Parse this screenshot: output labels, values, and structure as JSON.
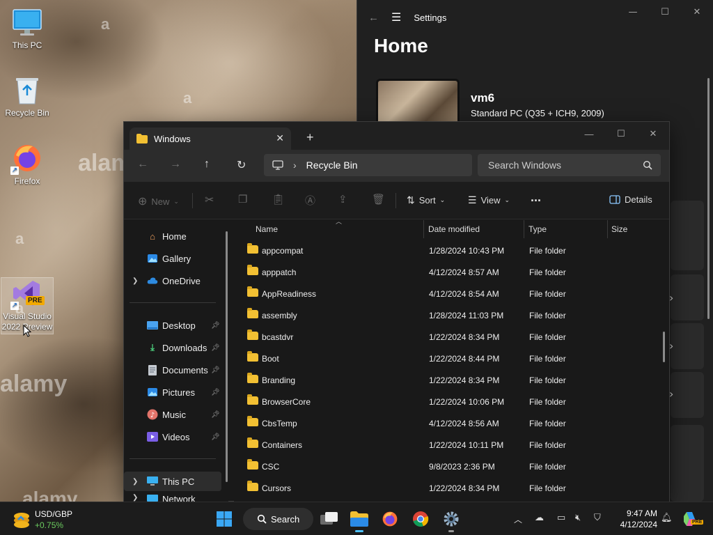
{
  "desktop": {
    "icons": [
      {
        "label": "This PC"
      },
      {
        "label": "Recycle Bin"
      },
      {
        "label": "Firefox"
      },
      {
        "label": "Visual Studio 2022 Preview",
        "badge": "PRE"
      }
    ],
    "watermarks": [
      "a",
      "alamy",
      "alamy",
      "a",
      "a",
      "a",
      "alamy"
    ]
  },
  "settings": {
    "title": "Settings",
    "heading": "Home",
    "device_name": "vm6",
    "device_spec": "Standard PC (Q35 + ICH9, 2009)"
  },
  "explorer": {
    "tab_title": "Windows",
    "breadcrumb": "Recycle Bin",
    "search_placeholder": "Search Windows",
    "commands": {
      "new": "New",
      "sort": "Sort",
      "view": "View",
      "more": "...",
      "details": "Details"
    },
    "nav": {
      "home": "Home",
      "gallery": "Gallery",
      "onedrive": "OneDrive",
      "desktop": "Desktop",
      "downloads": "Downloads",
      "documents": "Documents",
      "pictures": "Pictures",
      "music": "Music",
      "videos": "Videos",
      "this_pc": "This PC",
      "network": "Network"
    },
    "columns": {
      "name": "Name",
      "date": "Date modified",
      "type": "Type",
      "size": "Size"
    },
    "files": [
      {
        "name": "appcompat",
        "date": "1/28/2024 10:43 PM",
        "type": "File folder"
      },
      {
        "name": "apppatch",
        "date": "4/12/2024 8:57 AM",
        "type": "File folder"
      },
      {
        "name": "AppReadiness",
        "date": "4/12/2024 8:54 AM",
        "type": "File folder"
      },
      {
        "name": "assembly",
        "date": "1/28/2024 11:03 PM",
        "type": "File folder"
      },
      {
        "name": "bcastdvr",
        "date": "1/22/2024 8:34 PM",
        "type": "File folder"
      },
      {
        "name": "Boot",
        "date": "1/22/2024 8:44 PM",
        "type": "File folder"
      },
      {
        "name": "Branding",
        "date": "1/22/2024 8:34 PM",
        "type": "File folder"
      },
      {
        "name": "BrowserCore",
        "date": "1/22/2024 10:06 PM",
        "type": "File folder"
      },
      {
        "name": "CbsTemp",
        "date": "4/12/2024 8:56 AM",
        "type": "File folder"
      },
      {
        "name": "Containers",
        "date": "1/22/2024 10:11 PM",
        "type": "File folder"
      },
      {
        "name": "CSC",
        "date": "9/8/2023 2:36 PM",
        "type": "File folder"
      },
      {
        "name": "Cursors",
        "date": "1/22/2024 8:34 PM",
        "type": "File folder"
      }
    ]
  },
  "taskbar": {
    "widget_ticker": "USD/GBP",
    "widget_change": "+0.75%",
    "search_label": "Search",
    "time": "9:47 AM",
    "date": "4/12/2024",
    "copilot_badge": "PRE"
  },
  "colors": {
    "accent": "#4cc2ff",
    "folder": "#f2c033",
    "widget_change": "#6ccb5f"
  }
}
